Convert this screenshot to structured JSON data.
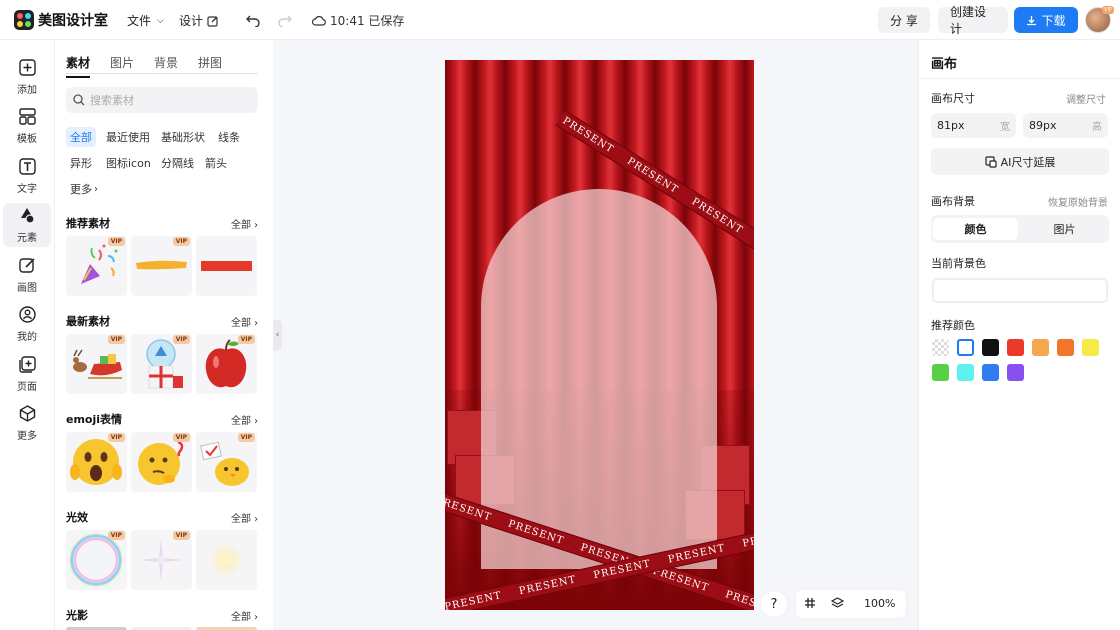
{
  "app": {
    "name": "美图设计室"
  },
  "topbar": {
    "file_label": "文件",
    "design_label": "设计",
    "save_status": "10:41 已保存",
    "share_label": "分 享",
    "create_label": "创建设计",
    "download_label": "下载",
    "avatar_badge": "VIP"
  },
  "leftnav": {
    "items": [
      {
        "label": "添加",
        "icon": "plus-square-icon"
      },
      {
        "label": "模板",
        "icon": "template-icon"
      },
      {
        "label": "文字",
        "icon": "text-icon"
      },
      {
        "label": "元素",
        "icon": "shapes-icon"
      },
      {
        "label": "画图",
        "icon": "draw-icon"
      },
      {
        "label": "我的",
        "icon": "user-icon"
      },
      {
        "label": "页面",
        "icon": "page-add-icon"
      },
      {
        "label": "更多",
        "icon": "cube-icon"
      }
    ],
    "active": "元素"
  },
  "panel": {
    "tabs": [
      "素材",
      "图片",
      "背景",
      "拼图"
    ],
    "active_tab": "素材",
    "search_placeholder": "搜索素材",
    "chips": [
      "全部",
      "最近使用",
      "基础形状",
      "线条",
      "异形",
      "图标icon",
      "分隔线",
      "箭头",
      "更多"
    ],
    "all_label": "全部",
    "sections": [
      {
        "title": "推荐素材",
        "items": [
          {
            "name": "party-popper",
            "vip": true
          },
          {
            "name": "yellow-brush-stroke",
            "vip": true
          },
          {
            "name": "red-bar",
            "vip": false
          }
        ]
      },
      {
        "title": "最新素材",
        "items": [
          {
            "name": "reindeer-sleigh",
            "vip": true
          },
          {
            "name": "snow-globe-gifts",
            "vip": true
          },
          {
            "name": "red-apple",
            "vip": true
          }
        ]
      },
      {
        "title": "emoji表情",
        "items": [
          {
            "name": "shocked-emoji",
            "vip": true
          },
          {
            "name": "thinking-emoji",
            "vip": true
          },
          {
            "name": "chick-sign-emoji",
            "vip": true
          }
        ]
      },
      {
        "title": "光效",
        "items": [
          {
            "name": "bubble-ring",
            "vip": true
          },
          {
            "name": "sparkle-star",
            "vip": true
          },
          {
            "name": "soft-glow",
            "vip": false
          }
        ]
      },
      {
        "title": "光影",
        "items": []
      }
    ],
    "vip_label": "VIP"
  },
  "canvas": {
    "ribbon_text": "PRESENT",
    "zoom": "100%",
    "help": "?"
  },
  "rpanel": {
    "title": "画布",
    "size_label": "画布尺寸",
    "adjust_size": "调整尺寸",
    "width_value": "81px",
    "width_unit": "宽",
    "height_value": "89px",
    "height_unit": "高",
    "ai_extend": "AI尺寸延展",
    "bg_label": "画布背景",
    "restore_bg": "恢复原始背景",
    "seg_color": "颜色",
    "seg_image": "图片",
    "current_bg_label": "当前背景色",
    "recommend_label": "推荐颜色",
    "swatches": [
      "transparent",
      "#ffffff",
      "#111111",
      "#ea3a2a",
      "#f4a950",
      "#f1752a",
      "#f4ec44",
      "#57d046",
      "#5ff0f0",
      "#2f7df0",
      "#8a4ff0"
    ]
  }
}
